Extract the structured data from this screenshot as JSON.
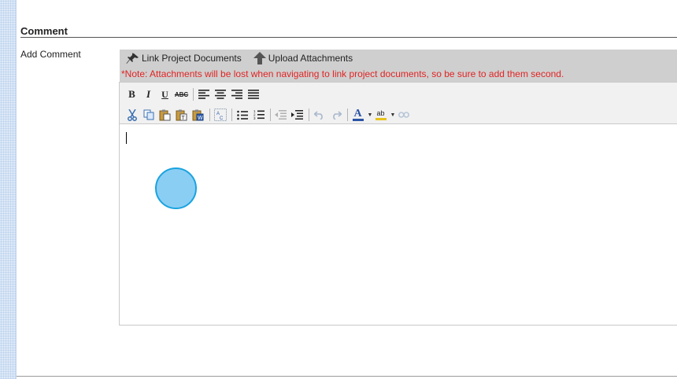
{
  "section": {
    "title": "Comment"
  },
  "field": {
    "label": "Add Comment"
  },
  "attachments": {
    "link_label": "Link Project Documents",
    "upload_label": "Upload Attachments",
    "note": "*Note: Attachments will be lost when navigating to link project documents, so be sure to add them second."
  },
  "toolbar": {
    "bold": "B",
    "italic": "I",
    "underline": "U",
    "strike": "ABC",
    "font_color_glyph": "A",
    "highlight_glyph": "ab"
  },
  "colors": {
    "note_red": "#e02424",
    "attach_bar": "#cfcfcf",
    "font_color_bar": "#2a53a5",
    "highlight_bar": "#e8c21a"
  }
}
